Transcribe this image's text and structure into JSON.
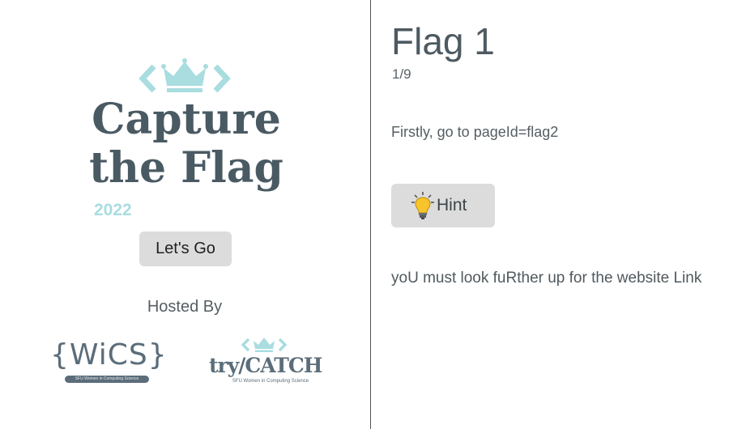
{
  "hero": {
    "title_line1": "Capture",
    "title_line2": "the Flag",
    "year": "2022",
    "icon": "crown-code-icon"
  },
  "cta": {
    "label": "Let's Go"
  },
  "hosts": {
    "heading": "Hosted By",
    "wics": {
      "text": "{WiCS}",
      "tagline": "SFU Women in Computing Science"
    },
    "trycatch": {
      "text": "try/CATCH",
      "tagline": "SFU Women in Computing Science",
      "icon": "crown-code-icon"
    }
  },
  "flag": {
    "title": "Flag 1",
    "progress": "1/9",
    "instruction": "Firstly, go to pageId=flag2",
    "hint_button": {
      "label": "Hint",
      "icon": "lightbulb-icon"
    },
    "hint_text": "yoU must look fuRther up for the website Link"
  },
  "colors": {
    "accent": "#a9dde0",
    "title": "#4a5a63",
    "button_bg": "#dcdcdc",
    "divider": "#555555"
  }
}
